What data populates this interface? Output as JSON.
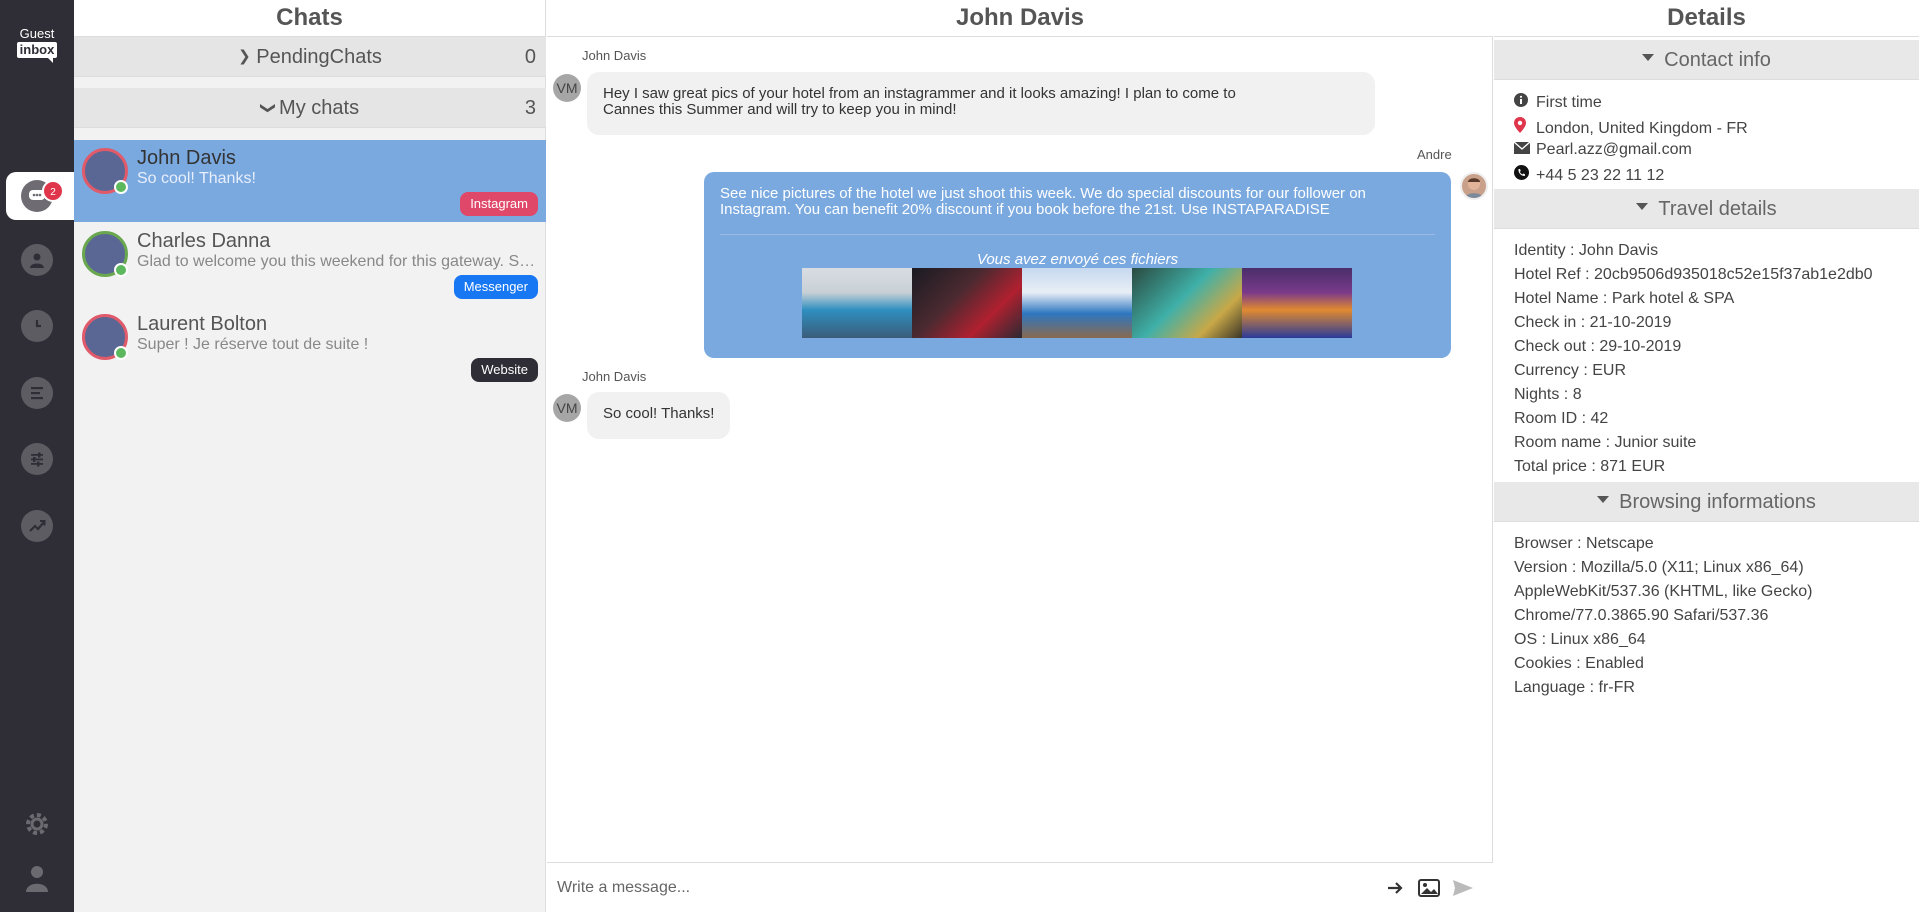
{
  "nav": {
    "logo_top": "Guest",
    "logo_bottom": "inbox",
    "chat_badge": "2",
    "icons": [
      "chat-icon",
      "user-icon",
      "clock-icon",
      "list-icon",
      "sliders-icon",
      "trend-icon",
      "gear-icon",
      "profile-icon"
    ]
  },
  "chats": {
    "title": "Chats",
    "pending": {
      "label": "PendingChats",
      "count": "0"
    },
    "mine": {
      "label": "My chats",
      "count": "3"
    },
    "items": [
      {
        "name": "John Davis",
        "message": "So cool! Thanks!",
        "source": "Instagram",
        "source_color": "#e0486a",
        "active": true
      },
      {
        "name": "Charles Danna",
        "message": "Glad to welcome you this weekend for this gateway. See you soon",
        "source": "Messenger",
        "source_color": "#1877f2",
        "active": false
      },
      {
        "name": "Laurent Bolton",
        "message": "Super ! Je réserve tout de suite !",
        "source": "Website",
        "source_color": "#2f2d35",
        "active": false
      }
    ]
  },
  "conversation": {
    "title": "John Davis",
    "messages": [
      {
        "sender": "John Davis",
        "avatar": "VM",
        "text_line1": "Hey I saw great pics of your hotel from an instagrammer and it looks amazing! I plan to come to",
        "text_line2": "Cannes this Summer and will try to keep you in mind!"
      },
      {
        "sender": "Andre",
        "text_line1": "See nice pictures of the hotel we just shoot this week. We do special discounts for our follower on",
        "text_line2": "Instagram. You can benefit 20% discount if you book before the 21st. Use INSTAPARADISE",
        "files_title": "Vous avez envoyé ces fichiers"
      },
      {
        "sender": "John Davis",
        "avatar": "VM",
        "text": "So cool! Thanks!"
      }
    ],
    "compose_placeholder": "Write a message..."
  },
  "details": {
    "title": "Details",
    "contact": {
      "heading": "Contact info",
      "first_time": "First time",
      "location": "London, United Kingdom - FR",
      "email": "Pearl.azz@gmail.com",
      "phone": "+44 5 23 22 11 12"
    },
    "travel": {
      "heading": "Travel details",
      "identity": "Identity : John Davis",
      "hotel_ref": "Hotel Ref : 20cb9506d935018c52e15f37ab1e2db0",
      "hotel_name": "Hotel Name : Park hotel & SPA",
      "check_in": "Check in : 21-10-2019",
      "check_out": "Check out : 29-10-2019",
      "currency": "Currency : EUR",
      "nights": "Nights : 8",
      "room_id": "Room ID : 42",
      "room_name": "Room name : Junior suite",
      "total_price": "Total price : 871 EUR"
    },
    "browsing": {
      "heading": "Browsing informations",
      "browser": "Browser : Netscape",
      "version": "Version : Mozilla/5.0 (X11; Linux x86_64)",
      "version2": "AppleWebKit/537.36 (KHTML, like Gecko)",
      "version3": "Chrome/77.0.3865.90 Safari/537.36",
      "os": "OS : Linux x86_64",
      "cookies": "Cookies : Enabled",
      "language": "Language : fr-FR"
    }
  }
}
